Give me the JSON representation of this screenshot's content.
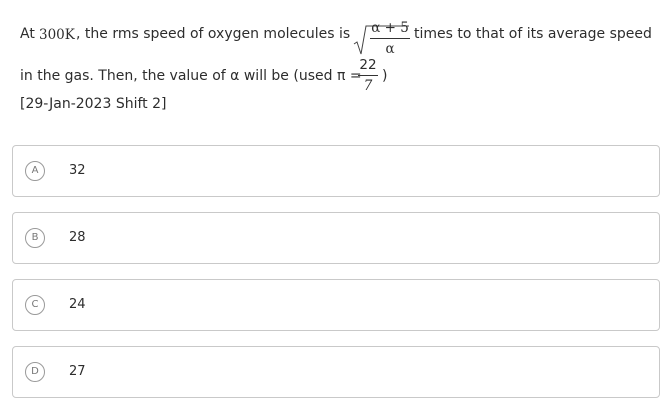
{
  "question": {
    "part1_a": "At ",
    "part1_b": "300K",
    "part1_c": ", the rms speed of oxygen molecules is",
    "sqrt_numerator": "α + 5",
    "sqrt_denominator": "α",
    "part1_d": "times to that of its average speed",
    "part2_a": "in the gas. Then, the value of α will be (used π =",
    "pi_numerator": "22",
    "pi_denominator": "7",
    "part2_b": ")",
    "tag": "[29-Jan-2023 Shift 2]"
  },
  "options": [
    {
      "letter": "A",
      "value": "32"
    },
    {
      "letter": "B",
      "value": "28"
    },
    {
      "letter": "C",
      "value": "24"
    },
    {
      "letter": "D",
      "value": "27"
    }
  ]
}
